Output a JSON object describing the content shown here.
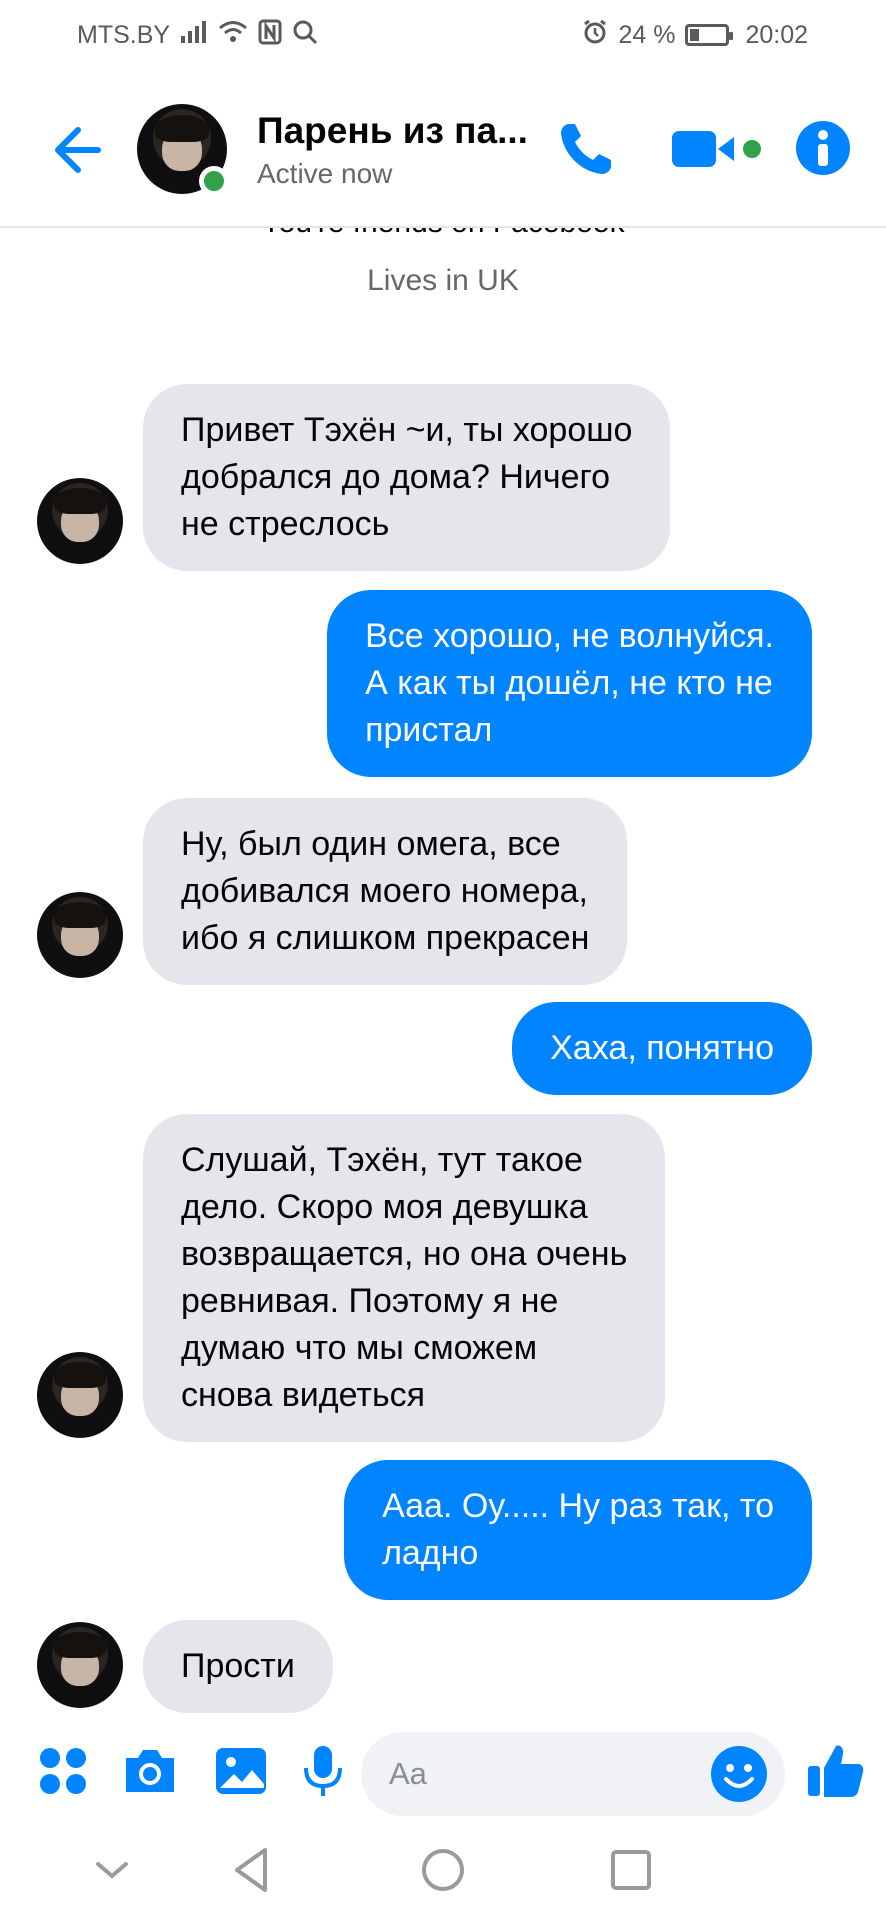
{
  "status_bar": {
    "carrier": "MTS.BY",
    "battery_percent": "24 %",
    "battery_level": 0.24,
    "time": "20:02",
    "icons": [
      "signal-icon",
      "wifi-icon",
      "nfc-icon",
      "search-icon",
      "alarm-icon",
      "battery-icon"
    ]
  },
  "header": {
    "contact_name": "Парень из па...",
    "status": "Active now",
    "icons": [
      "back-arrow-icon",
      "phone-icon",
      "video-camera-icon",
      "info-icon"
    ]
  },
  "chat": {
    "profile_cut_text": "You're friends on Facebook",
    "profile_location": "Lives in UK",
    "messages": [
      {
        "direction": "incoming",
        "text": "Привет Тэхён ~и, ты хорошо\nдобрался до дома? Ничего\nне стреслось"
      },
      {
        "direction": "outgoing",
        "text": "Все хорошо, не волнуйся.\nА как ты дошёл, не кто не\nпристал"
      },
      {
        "direction": "incoming",
        "text": "Ну, был один омега, все\nдобивался моего номера,\nибо я слишком прекрасен"
      },
      {
        "direction": "outgoing",
        "text": "Хаха, понятно"
      },
      {
        "direction": "incoming",
        "text": "Слушай, Тэхён, тут такое\nдело. Скоро моя девушка\nвозвращается, но она очень\nревнивая. Поэтому я не\nдумаю что мы сможем\nснова видеться"
      },
      {
        "direction": "outgoing",
        "text": "Ааа. Оу..... Ну раз так, то\nладно"
      },
      {
        "direction": "incoming",
        "text": "Прости"
      }
    ]
  },
  "composer": {
    "placeholder": "Aa",
    "icons": [
      "apps-grid-icon",
      "camera-icon",
      "gallery-icon",
      "microphone-icon",
      "emoji-icon",
      "thumbs-up-icon"
    ]
  },
  "navbar": {
    "icons": [
      "collapse-chevron-icon",
      "back-triangle-icon",
      "home-circle-icon",
      "recents-square-icon"
    ]
  },
  "colors": {
    "accent": "#0084ff",
    "incoming_bubble": "#e4e6eb",
    "online": "#31a24c"
  }
}
